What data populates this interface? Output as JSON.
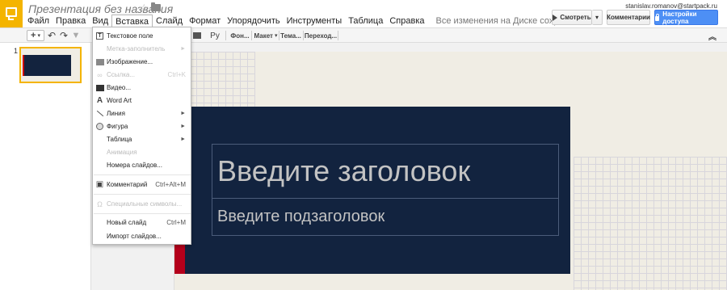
{
  "header": {
    "doc_title": "Презентация без названия",
    "star_icon": "star-icon",
    "folder_icon": "folder-icon",
    "save_status": "Все изменения на Диске сохранены",
    "user_email": "stanislav.romanov@startpack.ru",
    "present_label": "Смотреть",
    "comments_label": "Комментарии",
    "share_label": "Настройки доступа"
  },
  "menu": {
    "file": "Файл",
    "edit": "Правка",
    "view": "Вид",
    "insert": "Вставка",
    "slide": "Слайд",
    "format": "Формат",
    "arrange": "Упорядочить",
    "tools": "Инструменты",
    "table": "Таблица",
    "help": "Справка"
  },
  "toolbar": {
    "lang": "Ру",
    "background": "Фон...",
    "layout": "Макет",
    "theme": "Тема...",
    "transition": "Переход..."
  },
  "filmstrip": {
    "slide_number": "1"
  },
  "slide": {
    "title_placeholder": "Введите заголовок",
    "subtitle_placeholder": "Введите подзаголовок"
  },
  "insert_menu": {
    "text_box": "Текстовое поле",
    "placeholder": "Метка-заполнитель",
    "image": "Изображение...",
    "link": "Ссылка...",
    "link_shortcut": "Ctrl+K",
    "video": "Видео...",
    "word_art": "Word Art",
    "line": "Линия",
    "shape": "Фигура",
    "table": "Таблица",
    "animation": "Анимация",
    "slide_numbers": "Номера слайдов...",
    "comment": "Комментарий",
    "comment_shortcut": "Ctrl+Alt+M",
    "special_chars": "Специальные символы...",
    "new_slide": "Новый слайд",
    "new_slide_shortcut": "Ctrl+M",
    "import_slides": "Импорт слайдов..."
  },
  "colors": {
    "accent_yellow": "#f4b400",
    "share_blue": "#4d8ff5",
    "slide_navy": "#12233f",
    "slide_red": "#b4001b"
  }
}
